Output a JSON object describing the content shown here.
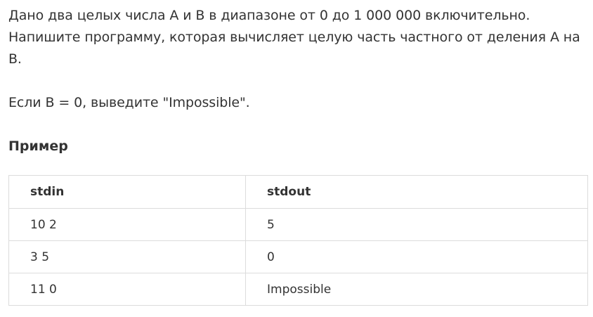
{
  "problem": {
    "statement": "Дано два целых числа A и B в диапазоне от 0 до 1 000 000 включительно. Напишите программу, которая вычисляет целую часть частного от деления A на B.",
    "note": "Если B = 0, выведите \"Impossible\"."
  },
  "example": {
    "title": "Пример",
    "columns": [
      "stdin",
      "stdout"
    ],
    "rows": [
      [
        "10 2",
        "5"
      ],
      [
        "3 5",
        "0"
      ],
      [
        "11 0",
        "Impossible"
      ]
    ]
  }
}
